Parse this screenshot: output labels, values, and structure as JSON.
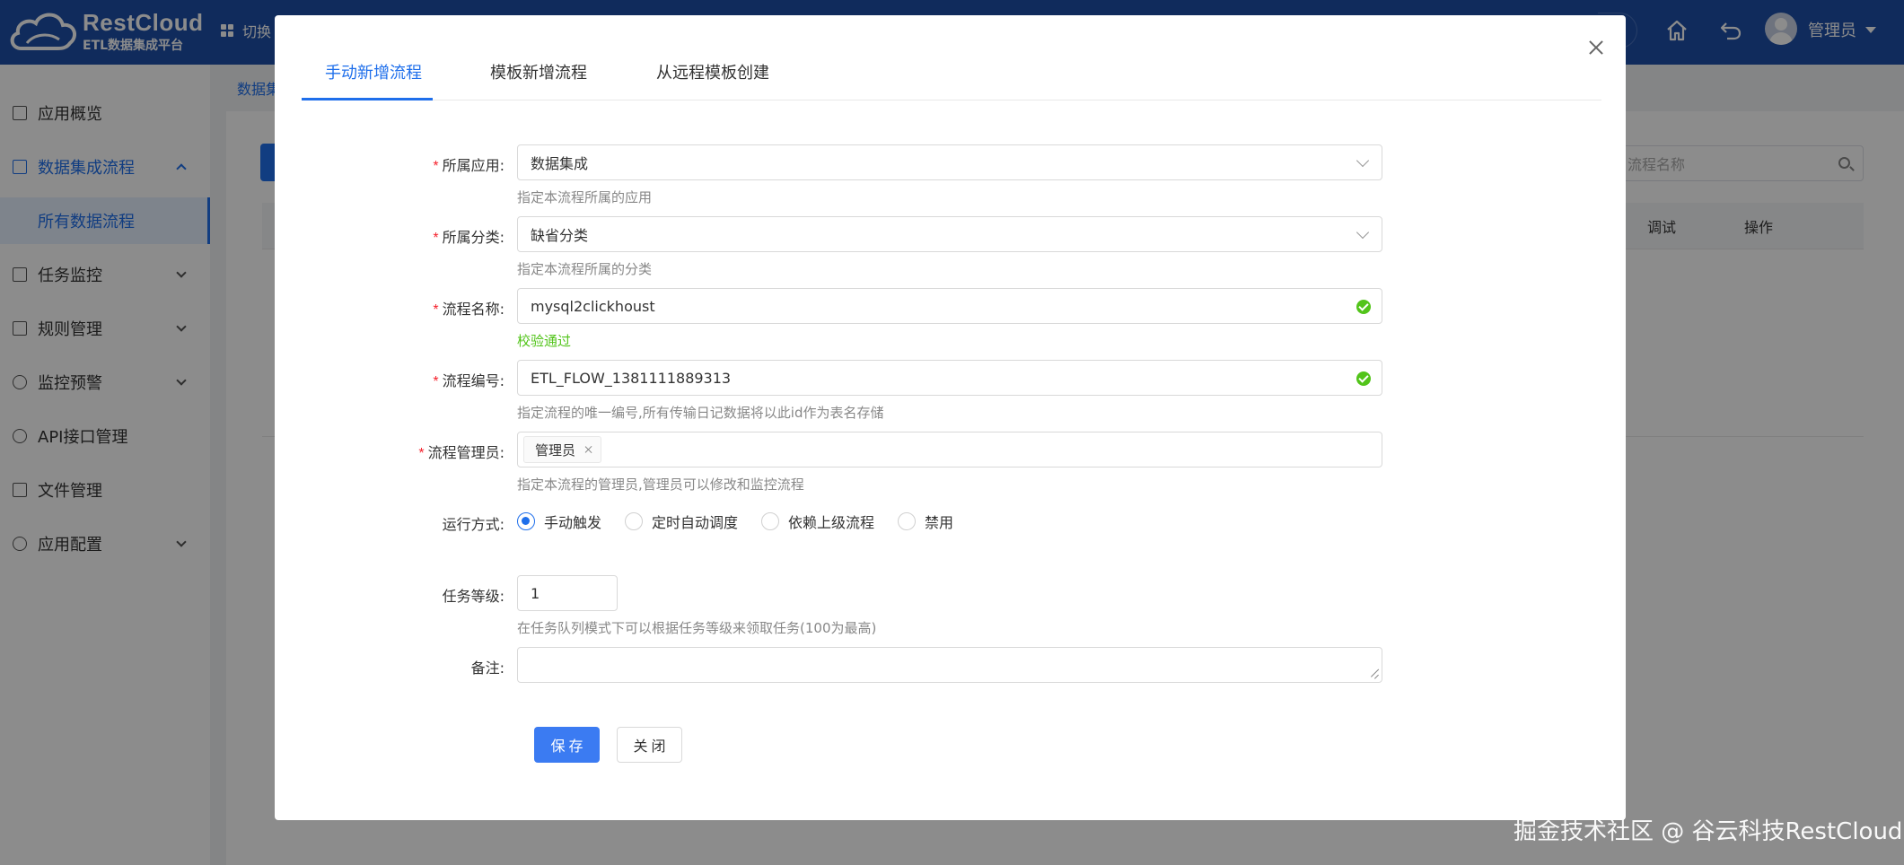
{
  "app": {
    "logo_title": "RestCloud",
    "logo_subtitle": "ETL数据集成平台",
    "switch_label": "切换",
    "user_name": "管理员"
  },
  "sidebar": {
    "items": [
      {
        "label": "应用概览",
        "icon": "overview-icon"
      },
      {
        "label": "数据集成流程",
        "icon": "dashboard-icon",
        "expanded": true
      },
      {
        "label": "任务监控",
        "icon": "monitor-icon"
      },
      {
        "label": "规则管理",
        "icon": "rules-icon"
      },
      {
        "label": "监控预警",
        "icon": "alarm-icon"
      },
      {
        "label": "API接口管理",
        "icon": "api-icon"
      },
      {
        "label": "文件管理",
        "icon": "file-icon"
      },
      {
        "label": "应用配置",
        "icon": "gear-icon"
      }
    ],
    "active_sub_item": "所有数据流程"
  },
  "background": {
    "breadcrumb": "数据集",
    "search_placeholder": "流程名称",
    "table_headers": [
      "调试",
      "操作"
    ]
  },
  "modal": {
    "tabs": [
      "手动新增流程",
      "模板新增流程",
      "从远程模板创建"
    ],
    "active_tab": 0,
    "form": {
      "app": {
        "label": "所属应用:",
        "value": "数据集成",
        "help": "指定本流程所属的应用"
      },
      "category": {
        "label": "所属分类:",
        "value": "缺省分类",
        "help": "指定本流程所属的分类"
      },
      "flow_name": {
        "label": "流程名称:",
        "value": "mysql2clickhoust",
        "validation": "校验通过"
      },
      "flow_id": {
        "label": "流程编号:",
        "value": "ETL_FLOW_1381111889313",
        "help": "指定流程的唯一编号,所有传输日记数据将以此id作为表名存储"
      },
      "managers": {
        "label": "流程管理员:",
        "tags": [
          "管理员"
        ],
        "help": "指定本流程的管理员,管理员可以修改和监控流程"
      },
      "run_mode": {
        "label": "运行方式:",
        "options": [
          "手动触发",
          "定时自动调度",
          "依赖上级流程",
          "禁用"
        ],
        "selected": 0
      },
      "priority": {
        "label": "任务等级:",
        "value": "1",
        "help": "在任务队列模式下可以根据任务等级来领取任务(100为最高)"
      },
      "remark": {
        "label": "备注:",
        "value": ""
      }
    },
    "buttons": {
      "save": "保存",
      "close": "关闭"
    }
  },
  "watermark": "掘金技术社区 @ 谷云科技RestCloud",
  "colors": {
    "topbar": "#1e4fa8",
    "accent": "#1f6feb",
    "success": "#52c41a",
    "required": "#f5222d"
  }
}
